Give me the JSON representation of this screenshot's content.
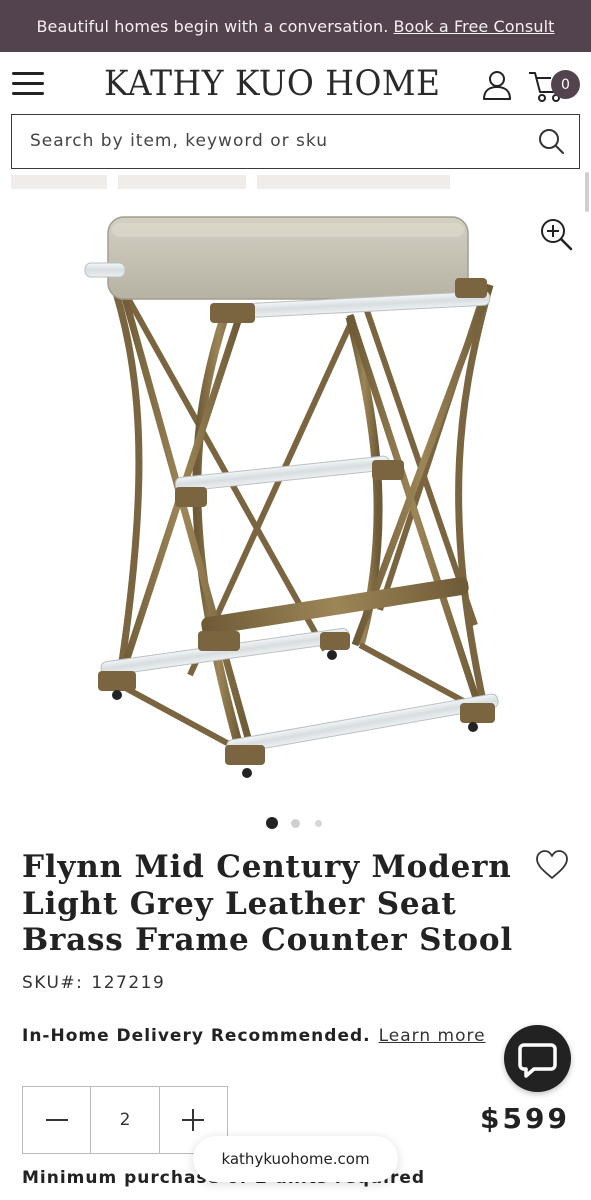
{
  "promo": {
    "text": "Beautiful homes begin with a conversation.",
    "link_label": "Book a Free Consult"
  },
  "header": {
    "logo": "KATHY KUO HOME",
    "cart_count": "0",
    "menu_icon": "hamburger-menu-icon",
    "account_icon": "user-icon",
    "cart_icon": "cart-icon"
  },
  "search": {
    "placeholder": "Search by item, keyword or sku",
    "value": ""
  },
  "gallery": {
    "image_alt": "Flynn counter stool with light grey leather seat and brass frame",
    "slide_count": 3,
    "active_slide": 1
  },
  "product": {
    "title": "Flynn Mid Century Modern Light Grey Leather Seat Brass Frame Counter Stool",
    "sku_label": "SKU#:",
    "sku_value": "127219",
    "delivery_label": "In-Home Delivery Recommended.",
    "learn_more": "Learn more",
    "quantity": "2",
    "price": "$599",
    "min_purchase": "Minimum purchase of 2 units required"
  },
  "browser": {
    "url": "kathykuohome.com"
  },
  "colors": {
    "promo_bg": "#53434f",
    "text": "#222222",
    "brass": "#8a7349",
    "leather": "#c9c4b6"
  }
}
